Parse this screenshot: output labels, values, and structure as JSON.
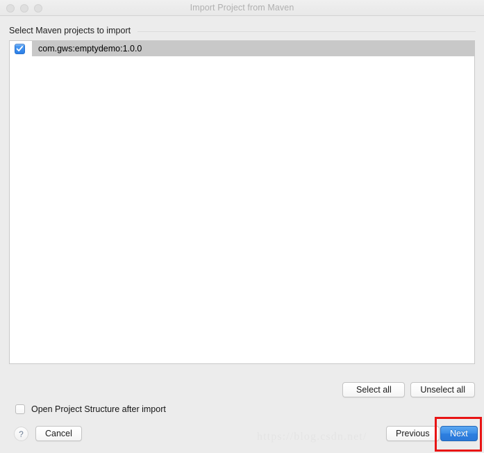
{
  "window": {
    "title": "Import Project from Maven",
    "traffic_lights": [
      "close-light",
      "minimize-light",
      "zoom-light"
    ]
  },
  "section": {
    "label": "Select Maven projects to import"
  },
  "project_list": {
    "rows": [
      {
        "label": "com.gws:emptydemo:1.0.0",
        "checked": true,
        "selected": true
      }
    ]
  },
  "selection_buttons": {
    "select_all": "Select all",
    "unselect_all": "Unselect all"
  },
  "options": {
    "open_project_structure": {
      "label": "Open Project Structure after import",
      "checked": false
    }
  },
  "footer": {
    "help": "?",
    "cancel": "Cancel",
    "previous": "Previous",
    "next": "Next"
  },
  "annotation": {
    "target": "next-button",
    "color": "#e81414"
  },
  "watermark": {
    "text": "https://blog.csdn.net/"
  },
  "colors": {
    "window_bg": "#ececec",
    "titlebar_bg": "#eeeeee",
    "list_bg": "#ffffff",
    "selection_bg": "#c8c8c8",
    "checkbox_blue": "#2b7fe8",
    "primary_button": "#3c8ee8",
    "annotation_red": "#e81414"
  }
}
